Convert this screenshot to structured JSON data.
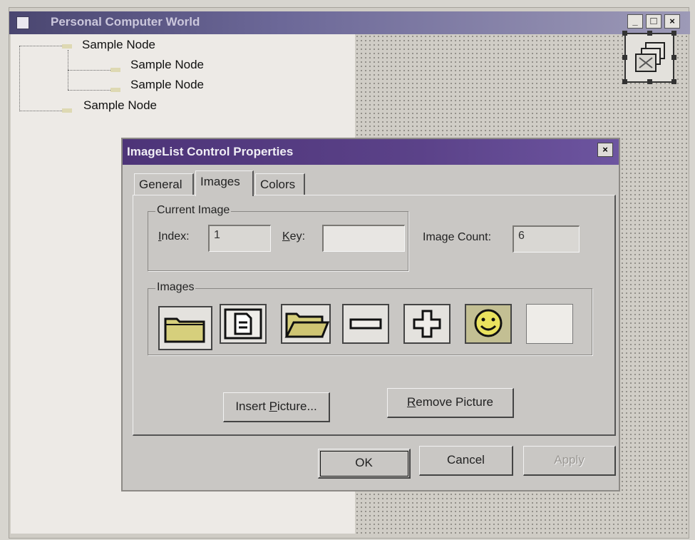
{
  "window": {
    "title": "Personal Computer World",
    "controls": {
      "minimize": "_",
      "maximize": "□",
      "close": "×"
    }
  },
  "tree": {
    "nodes": [
      {
        "label": "Sample Node",
        "level": 0
      },
      {
        "label": "Sample Node",
        "level": 1
      },
      {
        "label": "Sample Node",
        "level": 1
      },
      {
        "label": "Sample Node",
        "level": 0
      }
    ]
  },
  "dialog": {
    "title": "ImageList Control Properties",
    "close": "×",
    "tabs": [
      {
        "label": "General",
        "active": false
      },
      {
        "label": "Images",
        "active": true
      },
      {
        "label": "Colors",
        "active": false
      }
    ],
    "current_image": {
      "group_label": "Current Image",
      "index_label": "Index:",
      "index_value": "1",
      "key_label": "Key:",
      "key_value": "",
      "count_label": "Image Count:",
      "count_value": "6"
    },
    "images": {
      "group_label": "Images",
      "items": [
        "folder-closed-icon",
        "document-icon",
        "folder-open-icon",
        "minus-icon",
        "plus-icon",
        "smiley-icon",
        "empty-slot"
      ]
    },
    "buttons": {
      "insert": "Insert Picture...",
      "remove": "Remove Picture",
      "ok": "OK",
      "cancel": "Cancel",
      "apply": "Apply"
    }
  },
  "colors": {
    "dialog_titlebar": "#4d3478",
    "window_titlebar": "#4a4670",
    "face": "#c9c7c4"
  }
}
